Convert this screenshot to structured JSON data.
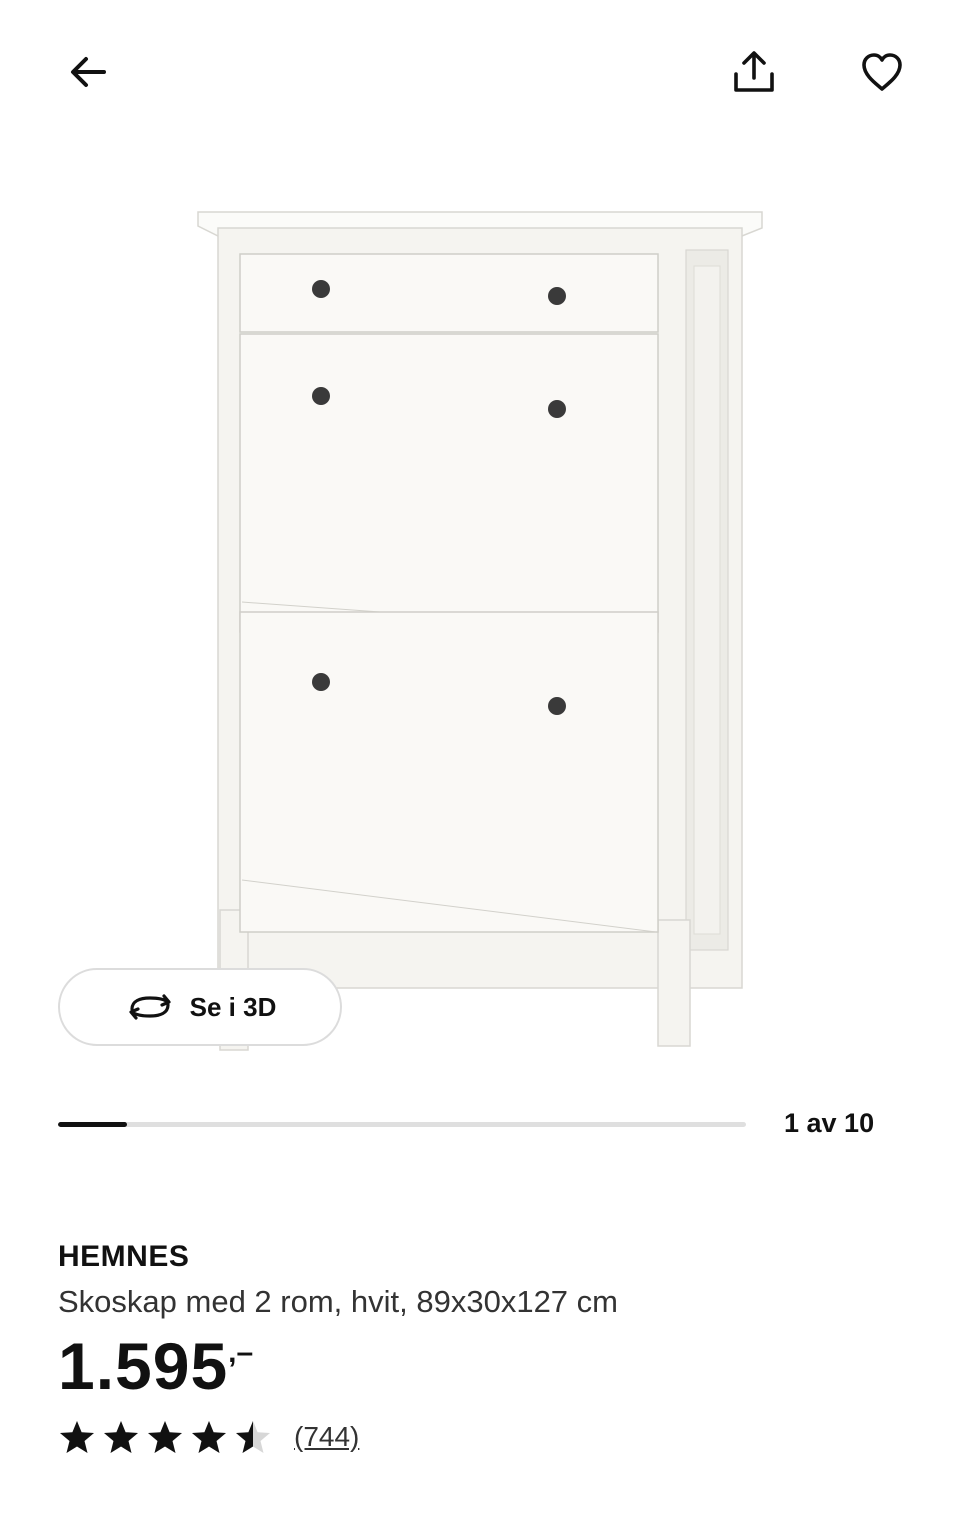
{
  "header": {
    "back_icon": "arrow-left-icon",
    "share_icon": "share-icon",
    "favorite_icon": "heart-icon"
  },
  "gallery": {
    "view3d_label": "Se i 3D",
    "view3d_icon": "rotate-3d-icon",
    "counter": "1 av 10",
    "current_index": 1,
    "total_images": 10
  },
  "product": {
    "name": "HEMNES",
    "description": "Skoskap med 2 rom, hvit, 89x30x127 cm",
    "price_integer": "1.595",
    "price_decimal": ",–",
    "rating": 4.5,
    "rating_max": 5,
    "review_count": "(744)"
  },
  "colors": {
    "text": "#111111",
    "border": "#dcdcdc",
    "track": "#dfdfdf",
    "furniture": "#f5f4f0",
    "knob": "#3a3a3a"
  }
}
